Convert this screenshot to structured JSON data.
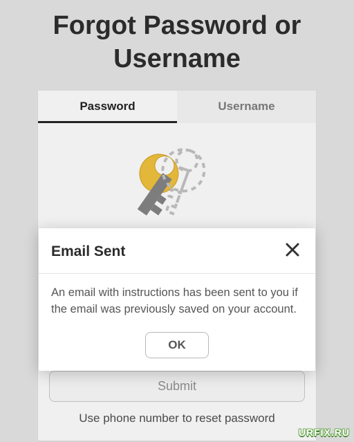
{
  "header": {
    "title": "Forgot Password or Username"
  },
  "tabs": {
    "password": "Password",
    "username": "Username",
    "active": "password"
  },
  "form": {
    "submit_label": "Submit",
    "alt_link": "Use phone number to reset password"
  },
  "modal": {
    "title": "Email Sent",
    "body": "An email with instructions has been sent to you if the email was previously saved on your account.",
    "ok_label": "OK"
  },
  "watermark": "URFIX.RU"
}
